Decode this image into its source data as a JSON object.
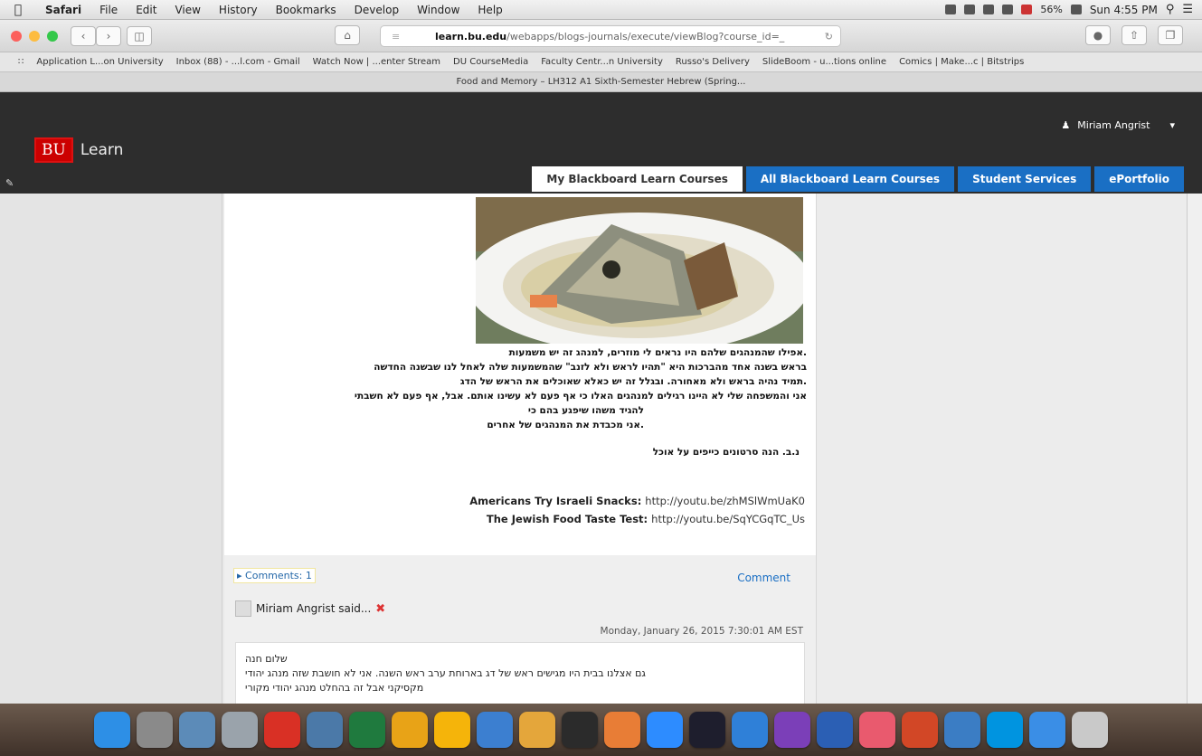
{
  "menubar": {
    "app": "Safari",
    "items": [
      "File",
      "Edit",
      "View",
      "History",
      "Bookmarks",
      "Develop",
      "Window",
      "Help"
    ],
    "battery": "56%",
    "clock": "Sun 4:55 PM"
  },
  "toolbar": {
    "url_domain": "learn.bu.edu",
    "url_path": "/webapps/blogs-journals/execute/viewBlog?course_id=_"
  },
  "bookmarks": [
    "Application L...on University",
    "Inbox (88) - ...l.com - Gmail",
    "Watch Now | ...enter Stream",
    "DU CourseMedia",
    "Faculty Centr...n University",
    "Russo's Delivery",
    "SlideBoom - u...tions online",
    "Comics | Make...c | Bitstrips"
  ],
  "tab": {
    "title": "Food and Memory – LH312 A1 Sixth-Semester Hebrew (Spring..."
  },
  "header": {
    "logo_mark": "BU",
    "logo_text": "Learn",
    "user_name": "Miriam Angrist",
    "nav": [
      "My Blackboard Learn Courses",
      "All Blackboard Learn Courses",
      "Student Services",
      "ePortfolio"
    ]
  },
  "post": {
    "paragraphs": [
      ".אפילו שהמנהגים שלהם היו נראים לי מוזרים, למנהג זה יש משמעות",
      "בראש בשנה אחד מהברכות היא \"תהיו לראש ולא לזנב\" שהמשמעות שלה לאחל לנו שבשנה החדשה",
      ".תמיד נהיה בראש ולא מאחורה. ובגלל זה יש כאלא שאוכלים את הראש של הדג",
      "אני והמשפחה שלי לא היינו רגילים למנהגים האלו כי אף פעם לא עשינו אותם. אבל, אף פעם לא חשבתי",
      "להגיד משהו שיפגע בהם כי",
      ".אני מכבדת את המנהגים של אחרים",
      "נ.ב. הנה סרטונים כייפים על אוכל"
    ],
    "links": [
      {
        "label": "Americans Try Israeli Snacks",
        "url": "http://youtu.be/zhMSlWmUaK0"
      },
      {
        "label": "The Jewish Food Taste Test",
        "url": "http://youtu.be/SqYCGqTC_Us"
      }
    ]
  },
  "comments": {
    "count_label": "Comments: 1",
    "comment_link": "Comment",
    "author": "Miriam Angrist said...",
    "date": "Monday, January 26, 2015 7:30:01 AM EST",
    "lines": [
      "שלום חנה",
      "גם אצלנו בבית היו מגישים ראש של דג בארוחת ערב ראש השנה. אני לא חושבת שזה מנהג יהודי",
      "מקסיקני אבל זה בהחלט מנהג יהודי מקורי"
    ]
  },
  "dock": {
    "icons": [
      {
        "name": "finder",
        "color": "#2d8fe6"
      },
      {
        "name": "system-preferences",
        "color": "#8a8a8a"
      },
      {
        "name": "preview",
        "color": "#5c8bb8"
      },
      {
        "name": "launchpad",
        "color": "#9aa3ab"
      },
      {
        "name": "acrobat",
        "color": "#d93025"
      },
      {
        "name": "image-capture",
        "color": "#4b79a8"
      },
      {
        "name": "excel",
        "color": "#1f7a3e"
      },
      {
        "name": "chrome",
        "color": "#e8a317"
      },
      {
        "name": "opera",
        "color": "#f5b40a"
      },
      {
        "name": "app-store",
        "color": "#3c7fd0"
      },
      {
        "name": "pages",
        "color": "#e4a63b"
      },
      {
        "name": "quicktime",
        "color": "#2b2b2b"
      },
      {
        "name": "keynote",
        "color": "#e87d36"
      },
      {
        "name": "zoom",
        "color": "#2d8cff"
      },
      {
        "name": "dashboard",
        "color": "#1e1e2d"
      },
      {
        "name": "safari",
        "color": "#2f80d8"
      },
      {
        "name": "visual-studio",
        "color": "#7b3fb8"
      },
      {
        "name": "word",
        "color": "#2b5fb4"
      },
      {
        "name": "photos",
        "color": "#e95a6e"
      },
      {
        "name": "powerpoint",
        "color": "#d24726"
      },
      {
        "name": "screen-sharing",
        "color": "#3b7dc4"
      },
      {
        "name": "skype",
        "color": "#0094e0"
      },
      {
        "name": "mail",
        "color": "#3a8ee6"
      },
      {
        "name": "trash",
        "color": "#c9c9c9"
      }
    ]
  }
}
